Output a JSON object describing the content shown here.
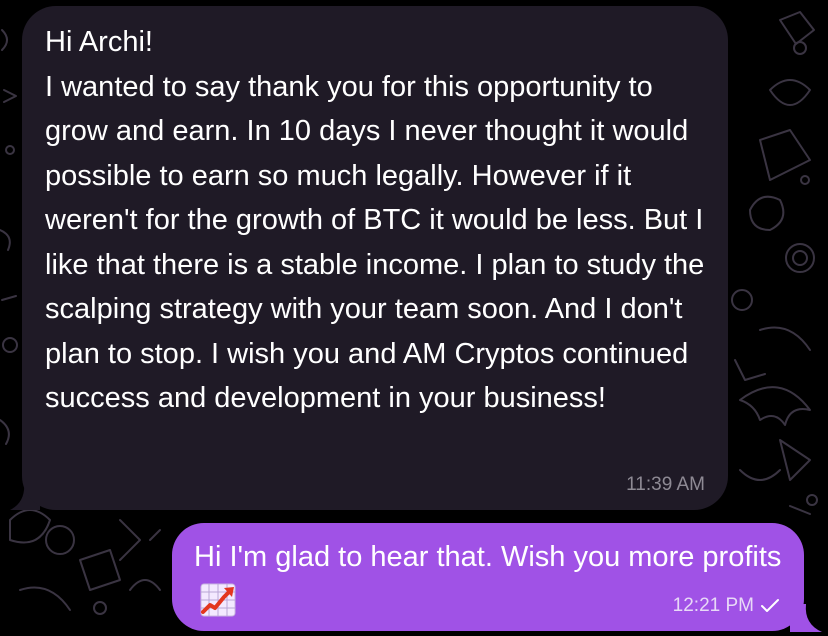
{
  "chat": {
    "incoming": {
      "text": "Hi Archi!\nI wanted to say thank you for this opportunity to grow and earn. In 10 days I never thought it would possible to earn so much legally. However if it weren't for the growth of BTC it would be less. But I like that there is a stable income. I plan to study the scalping strategy with your team soon. And I don't plan to stop. I wish you and AM Cryptos continued success and development in your business!",
      "time": "11:39 AM"
    },
    "outgoing": {
      "text": "Hi I'm glad to hear that. Wish you more profits",
      "emoji": "chart-increasing-icon",
      "time": "12:21 PM",
      "status": "sent"
    }
  },
  "colors": {
    "background": "#000000",
    "incoming_bubble": "#1f1a26",
    "outgoing_bubble": "#a052e6",
    "wallpaper_doodle": "#3a3442"
  }
}
